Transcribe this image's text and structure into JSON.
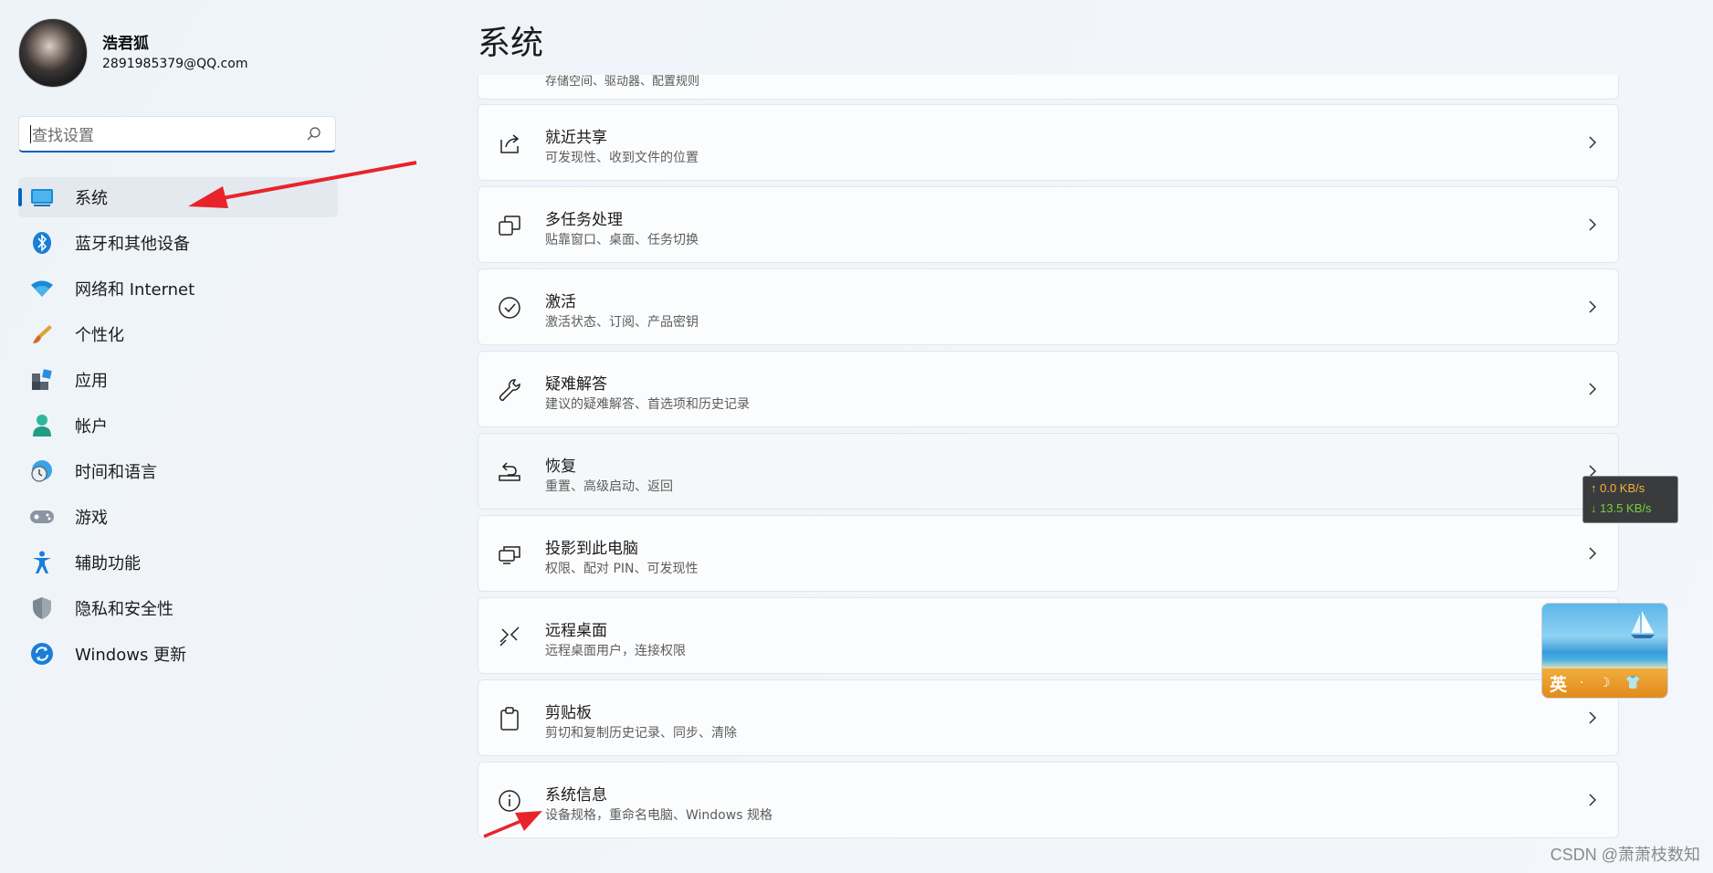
{
  "profile": {
    "name": "浩君狐",
    "email": "2891985379@QQ.com"
  },
  "search": {
    "placeholder": "查找设置"
  },
  "nav": [
    {
      "label": "系统",
      "icon": "system-monitor-icon",
      "active": true
    },
    {
      "label": "蓝牙和其他设备",
      "icon": "bluetooth-icon"
    },
    {
      "label": "网络和 Internet",
      "icon": "wifi-icon"
    },
    {
      "label": "个性化",
      "icon": "paintbrush-icon"
    },
    {
      "label": "应用",
      "icon": "apps-icon"
    },
    {
      "label": "帐户",
      "icon": "account-icon"
    },
    {
      "label": "时间和语言",
      "icon": "globe-clock-icon"
    },
    {
      "label": "游戏",
      "icon": "gamepad-icon"
    },
    {
      "label": "辅助功能",
      "icon": "accessibility-icon"
    },
    {
      "label": "隐私和安全性",
      "icon": "shield-icon"
    },
    {
      "label": "Windows 更新",
      "icon": "windows-update-icon"
    }
  ],
  "main": {
    "title": "系统",
    "partial_subtitle": "存储空间、驱动器、配置规则",
    "cards": [
      {
        "title": "就近共享",
        "subtitle": "可发现性、收到文件的位置",
        "icon": "share-icon"
      },
      {
        "title": "多任务处理",
        "subtitle": "贴靠窗口、桌面、任务切换",
        "icon": "multitask-icon"
      },
      {
        "title": "激活",
        "subtitle": "激活状态、订阅、产品密钥",
        "icon": "check-circle-icon"
      },
      {
        "title": "疑难解答",
        "subtitle": "建议的疑难解答、首选项和历史记录",
        "icon": "wrench-icon"
      },
      {
        "title": "恢复",
        "subtitle": "重置、高级启动、返回",
        "icon": "recovery-icon"
      },
      {
        "title": "投影到此电脑",
        "subtitle": "权限、配对 PIN、可发现性",
        "icon": "project-icon"
      },
      {
        "title": "远程桌面",
        "subtitle": "远程桌面用户，连接权限",
        "icon": "remote-desktop-icon"
      },
      {
        "title": "剪贴板",
        "subtitle": "剪切和复制历史记录、同步、清除",
        "icon": "clipboard-icon"
      },
      {
        "title": "系统信息",
        "subtitle": "设备规格，重命名电脑、Windows 规格",
        "icon": "info-icon"
      }
    ]
  },
  "netspeed": {
    "up": "↑ 0.0 KB/s",
    "down": "↓ 13.5 KB/s"
  },
  "ime": {
    "lang": "英",
    "icons": "· ☽ 👕"
  },
  "watermark": "CSDN @萧萧枝数知",
  "colors": {
    "accent": "#0067c0",
    "arrow": "#e8242b"
  }
}
